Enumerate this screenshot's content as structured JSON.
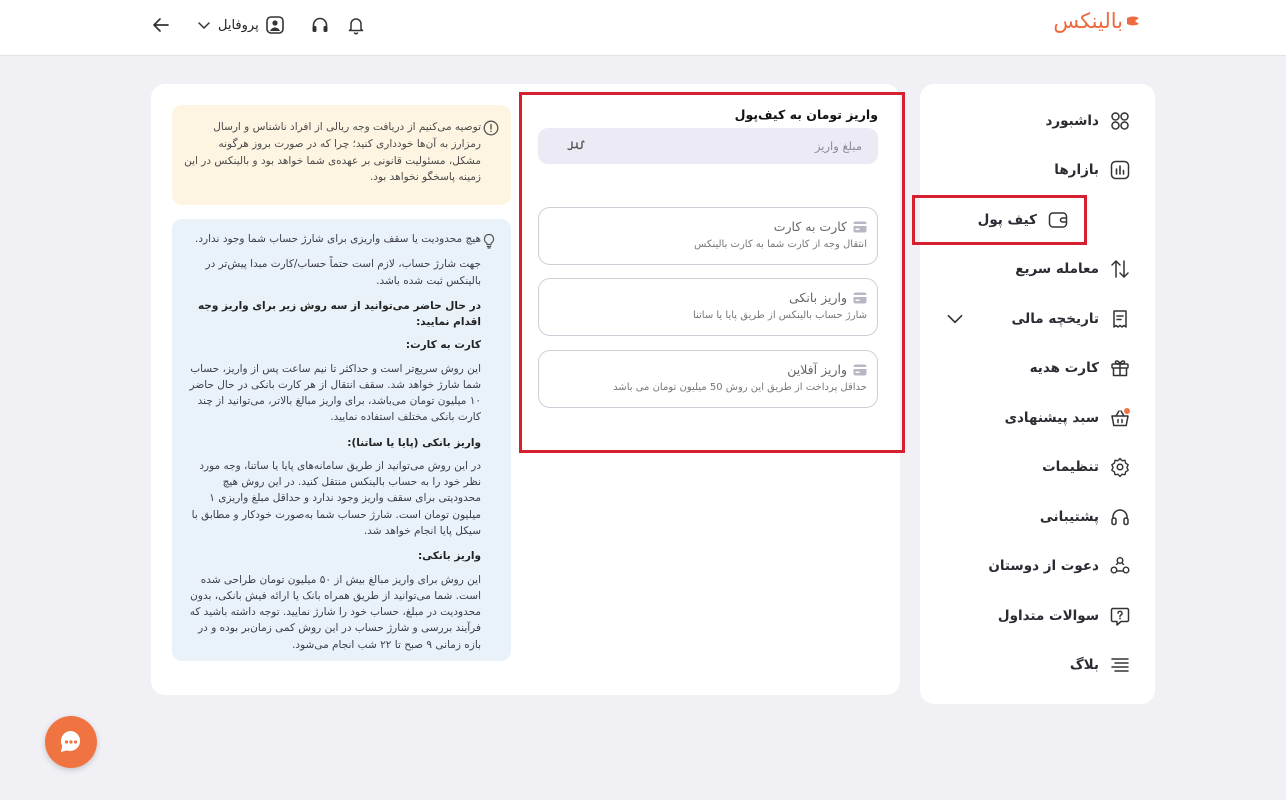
{
  "header": {
    "logo_text": "بالینکس",
    "profile_label": "پروفایل",
    "brand_color": "#ee6a3f"
  },
  "sidebar": {
    "items": [
      {
        "label": "داشبورد",
        "icon": "dashboard-grid-icon"
      },
      {
        "label": "بازارها",
        "icon": "chart-bars-icon"
      },
      {
        "label": "کیف پول",
        "icon": "wallet-icon",
        "active": true
      },
      {
        "label": "معامله سریع",
        "icon": "swap-arrows-icon"
      },
      {
        "label": "تاریخچه مالی",
        "icon": "receipt-icon",
        "expandable": true
      },
      {
        "label": "کارت هدیه",
        "icon": "gift-icon"
      },
      {
        "label": "سبد پیشنهادی",
        "icon": "basket-icon",
        "badge_color": "#ef7442"
      },
      {
        "label": "تنظیمات",
        "icon": "gear-icon"
      },
      {
        "label": "پشتیبانی",
        "icon": "headset-icon"
      },
      {
        "label": "دعوت از دوستان",
        "icon": "users-icon"
      },
      {
        "label": "سوالات متداول",
        "icon": "question-bubble-icon"
      },
      {
        "label": "بلاگ",
        "icon": "text-lines-icon"
      }
    ]
  },
  "deposit": {
    "title": "واریز تومان به کیف‌پول",
    "amount_placeholder": "مبلغ واریز",
    "methods": [
      {
        "title": "کارت به کارت",
        "desc": "انتقال وجه از کارت شما به کارت بالینکس"
      },
      {
        "title": "واریز بانکی",
        "desc": "شارژ حساب بالینکس از طریق پایا یا ساتنا"
      },
      {
        "title": "واریز آفلاین",
        "desc": "حداقل پرداخت از طریق این روش 50 میلیون تومان می باشد"
      }
    ]
  },
  "warning": {
    "text": "توصیه می‌کنیم از دریافت وجه ریالی از افراد ناشناس و ارسال رمزارز به آن‌ها خودداری کنید؛ چرا که در صورت بروز هرگونه مشکل، مسئولیت قانونی بر عهده‌ی شما خواهد بود و بالینکس در این زمینه پاسخگو نخواهد بود."
  },
  "info": {
    "line1": "هیچ محدودیت یا سقف واریزی برای شارژ حساب شما وجود ندارد.",
    "line2": "جهت شارژ حساب، لازم است حتماً حساب/کارت مبدا پیش‌تر در بالینکس ثبت شده باشد.",
    "line3": "در حال حاضر می‌توانید از سه روش زیر برای واریز وجه اقدام نمایید:",
    "card_head": "کارت به کارت:",
    "card_text": "این روش سریع‌تر است و حداکثر تا نیم ساعت پس از واریز، حساب شما شارژ خواهد شد. سقف انتقال از هر کارت بانکی در حال حاضر ۱۰ میلیون تومان می‌باشد، برای واریز مبالغ بالاتر، می‌توانید از چند کارت بانکی مختلف استفاده نمایید.",
    "paya_head": "واریز بانکی (پایا یا ساتنا):",
    "paya_text": "در این روش می‌توانید از طریق سامانه‌های پایا یا ساتنا، وجه مورد نظر خود را به حساب بالینکس منتقل کنید. در این روش هیچ محدودیتی برای سقف واریز وجود ندارد و حداقل مبلغ واریزی ۱ میلیون تومان است. شارژ حساب شما به‌صورت خودکار و مطابق با سیکل پایا انجام خواهد شد.",
    "bank_head": "واریز بانکی:",
    "bank_text": "این روش برای واریز مبالغ بیش از ۵۰ میلیون تومان طراحی شده است. شما می‌توانید از طریق همراه بانک یا ارائه فیش بانکی، بدون محدودیت در مبلغ، حساب خود را شارژ نمایید. توجه داشته باشید که فرآیند بررسی و شارژ حساب در این روش کمی زمان‌بر بوده و در بازه زمانی ۹ صبح تا ۲۲ شب انجام می‌شود."
  }
}
